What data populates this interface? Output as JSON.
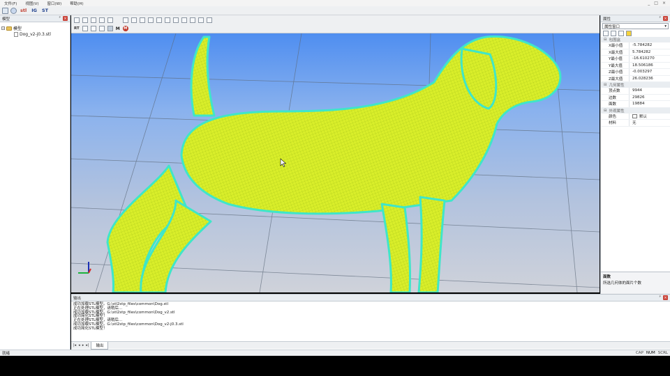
{
  "menubar": {
    "items": [
      "文件(F)",
      "视图(V)",
      "窗口(W)",
      "帮助(H)"
    ],
    "window_controls": [
      "_",
      "□",
      "×"
    ]
  },
  "toolbar": {
    "format_buttons": [
      {
        "label": "stl",
        "color": "#c0392b"
      },
      {
        "label": "IG",
        "color": "#1f3f8c"
      },
      {
        "label": "ST",
        "color": "#1f3f8c"
      }
    ]
  },
  "model_panel": {
    "title": "模型",
    "pin": "ᵖ",
    "close": "×",
    "root": "模型",
    "expander": "−",
    "file": "Dog_v2-j0.3.stl"
  },
  "view_toolbar": {
    "label_rt": "RT",
    "label_m1": "M",
    "label_m2": "M"
  },
  "properties": {
    "title": "属性",
    "pin": "ᵖ",
    "close": "×",
    "selector": "属性窗口",
    "selector_arrow": "▾",
    "categories": [
      {
        "name": "包围盒",
        "rows": [
          {
            "key": "X最小值",
            "value": "-5.784282"
          },
          {
            "key": "X最大值",
            "value": "5.784282"
          },
          {
            "key": "Y最小值",
            "value": "-16.610270"
          },
          {
            "key": "Y最大值",
            "value": "18.506186"
          },
          {
            "key": "Z最小值",
            "value": "-0.003297"
          },
          {
            "key": "Z最大值",
            "value": "26.028236"
          }
        ]
      },
      {
        "name": "几何属性",
        "rows": [
          {
            "key": "顶点数",
            "value": "9944"
          },
          {
            "key": "边数",
            "value": "29826"
          },
          {
            "key": "面数",
            "value": "19884"
          }
        ]
      },
      {
        "name": "外观属性",
        "rows": [
          {
            "key": "颜色",
            "value": "默认"
          },
          {
            "key": "材料",
            "value": "无"
          }
        ]
      }
    ],
    "description_title": "面数",
    "description_text": "所选几何体的面片个数"
  },
  "output": {
    "title": "输出",
    "pin": "ᵖ",
    "close": "×",
    "lines": [
      "成功加载STL模型。G:\\stl2stp_files\\common\\Dog.stl",
      "正在处理STL模型，请稍后...",
      "成功加载STL模型。G:\\stl2stp_files\\common\\Dog_v2.stl",
      "成功简化STL模型！",
      "正在处理STL模型，请稍后...",
      "成功加载STL模型。G:\\stl2stp_files\\common\\Dog_v2-j0.3.stl",
      "成功简化STL模型！"
    ],
    "tab": "输出",
    "nav": [
      "|◂",
      "◂",
      "▸",
      "▸|"
    ]
  },
  "statusbar": {
    "left": "就绪",
    "indicators": [
      "CAP",
      "NUM",
      "SCRL"
    ]
  },
  "colors": {
    "mesh_fill": "#d9ee2a",
    "mesh_edge": "#3fe6c8",
    "sky_top": "#4f8ef0",
    "floor": "#cfd2da"
  }
}
